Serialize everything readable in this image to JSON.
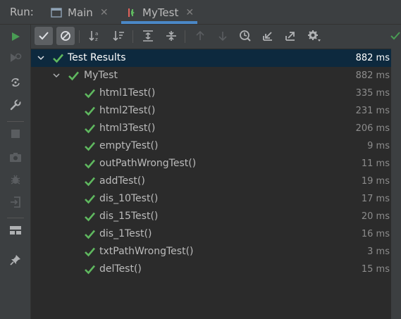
{
  "colors": {
    "pass_green": "#5fb85f",
    "selection": "#0d293e",
    "tab_underline": "#4a88c7",
    "run_green": "#499c54"
  },
  "header": {
    "run_label": "Run:",
    "tabs": [
      {
        "label": "Main",
        "icon": "window-icon",
        "active": false
      },
      {
        "label": "MyTest",
        "icon": "junit-icon",
        "active": true
      }
    ]
  },
  "toolbar": {
    "buttons": [
      "show-passed-icon",
      "show-ignored-icon",
      "sort-alphabetically-icon",
      "sort-by-duration-icon",
      "expand-all-icon",
      "collapse-all-icon",
      "previous-failed-icon",
      "next-failed-icon",
      "test-history-icon",
      "import-tests-icon",
      "export-tests-icon",
      "settings-icon"
    ]
  },
  "sidebar": {
    "buttons": [
      "rerun-icon",
      "rerun-failed-icon",
      "toggle-auto-test-icon",
      "settings-wrench-icon",
      "stop-icon",
      "screenshot-icon",
      "debug-icon",
      "exit-icon",
      "layout-icon",
      "pin-icon"
    ]
  },
  "tree": {
    "root": {
      "label": "Test Results",
      "time": "882 ms"
    },
    "suite": {
      "label": "MyTest",
      "time": "882 ms"
    },
    "tests": [
      {
        "label": "html1Test()",
        "time": "335 ms"
      },
      {
        "label": "html2Test()",
        "time": "231 ms"
      },
      {
        "label": "html3Test()",
        "time": "206 ms"
      },
      {
        "label": "emptyTest()",
        "time": "9 ms"
      },
      {
        "label": "outPathWrongTest()",
        "time": "11 ms"
      },
      {
        "label": "addTest()",
        "time": "19 ms"
      },
      {
        "label": "dis_10Test()",
        "time": "17 ms"
      },
      {
        "label": "dis_15Test()",
        "time": "20 ms"
      },
      {
        "label": "dis_1Test()",
        "time": "16 ms"
      },
      {
        "label": "txtPathWrongTest()",
        "time": "3 ms"
      },
      {
        "label": "delTest()",
        "time": "15 ms"
      }
    ]
  }
}
